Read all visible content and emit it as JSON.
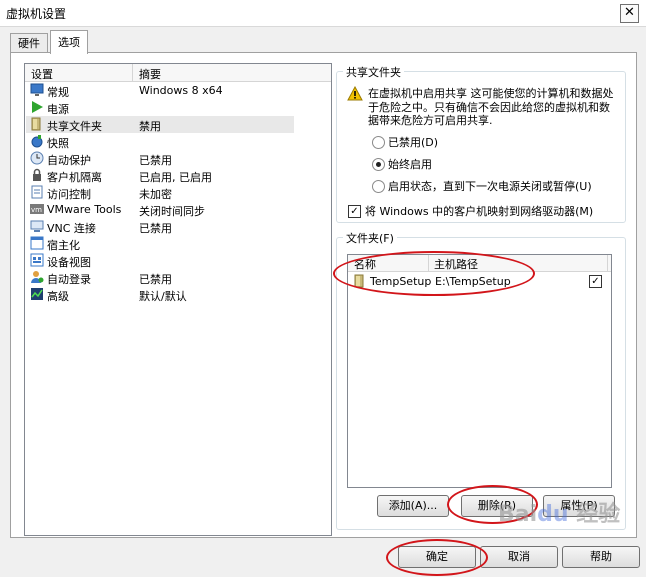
{
  "window": {
    "title": "虚拟机设置"
  },
  "tabs": [
    {
      "label": "硬件",
      "selected": false
    },
    {
      "label": "选项",
      "selected": true
    }
  ],
  "settings_list": {
    "columns": [
      "设置",
      "摘要"
    ],
    "items": [
      {
        "name": "常规",
        "value": "Windows 8 x64",
        "icon": "monitor-icon"
      },
      {
        "name": "电源",
        "value": "",
        "icon": "play-icon"
      },
      {
        "name": "共享文件夹",
        "value": "禁用",
        "icon": "folder-icon",
        "selected": true
      },
      {
        "name": "快照",
        "value": "",
        "icon": "camera-icon"
      },
      {
        "name": "自动保护",
        "value": "已禁用",
        "icon": "clock-icon"
      },
      {
        "name": "客户机隔离",
        "value": "已启用, 已启用",
        "icon": "lock-icon"
      },
      {
        "name": "访问控制",
        "value": "未加密",
        "icon": "document-icon"
      },
      {
        "name": "VMware Tools",
        "value": "关闭时间同步",
        "icon": "vm-icon"
      },
      {
        "name": "VNC 连接",
        "value": "已禁用",
        "icon": "vnc-icon"
      },
      {
        "name": "宿主化",
        "value": "",
        "icon": "window-icon"
      },
      {
        "name": "设备视图",
        "value": "",
        "icon": "devices-icon"
      },
      {
        "name": "自动登录",
        "value": "已禁用",
        "icon": "user-icon"
      },
      {
        "name": "高级",
        "value": "默认/默认",
        "icon": "chart-icon"
      }
    ]
  },
  "shared_folders": {
    "legend": "共享文件夹",
    "warning": "在虚拟机中启用共享 这可能使您的计算机和数据处于危险之中。只有确信不会因此给您的虚拟机和数据带来危险方可启用共享.",
    "options": [
      {
        "label": "已禁用(D)",
        "checked": false
      },
      {
        "label": "始终启用",
        "checked": true
      },
      {
        "label": "启用状态，直到下一次电源关闭或暂停(U)",
        "checked": false
      }
    ],
    "map_drive": {
      "label": "将 Windows 中的客户机映射到网络驱动器(M)",
      "checked": true
    }
  },
  "folders": {
    "legend": "文件夹(F)",
    "columns": [
      "名称",
      "主机路径"
    ],
    "rows": [
      {
        "name": "TempSetup",
        "path": "E:\\TempSetup",
        "enabled": true
      }
    ],
    "buttons": {
      "add": "添加(A)...",
      "remove": "删除(R)",
      "properties": "属性(P)"
    }
  },
  "footer": {
    "ok": "确定",
    "cancel": "取消",
    "help": "帮助"
  },
  "colors": {
    "annotation": "#d2151a",
    "warning": "#f2c200"
  }
}
